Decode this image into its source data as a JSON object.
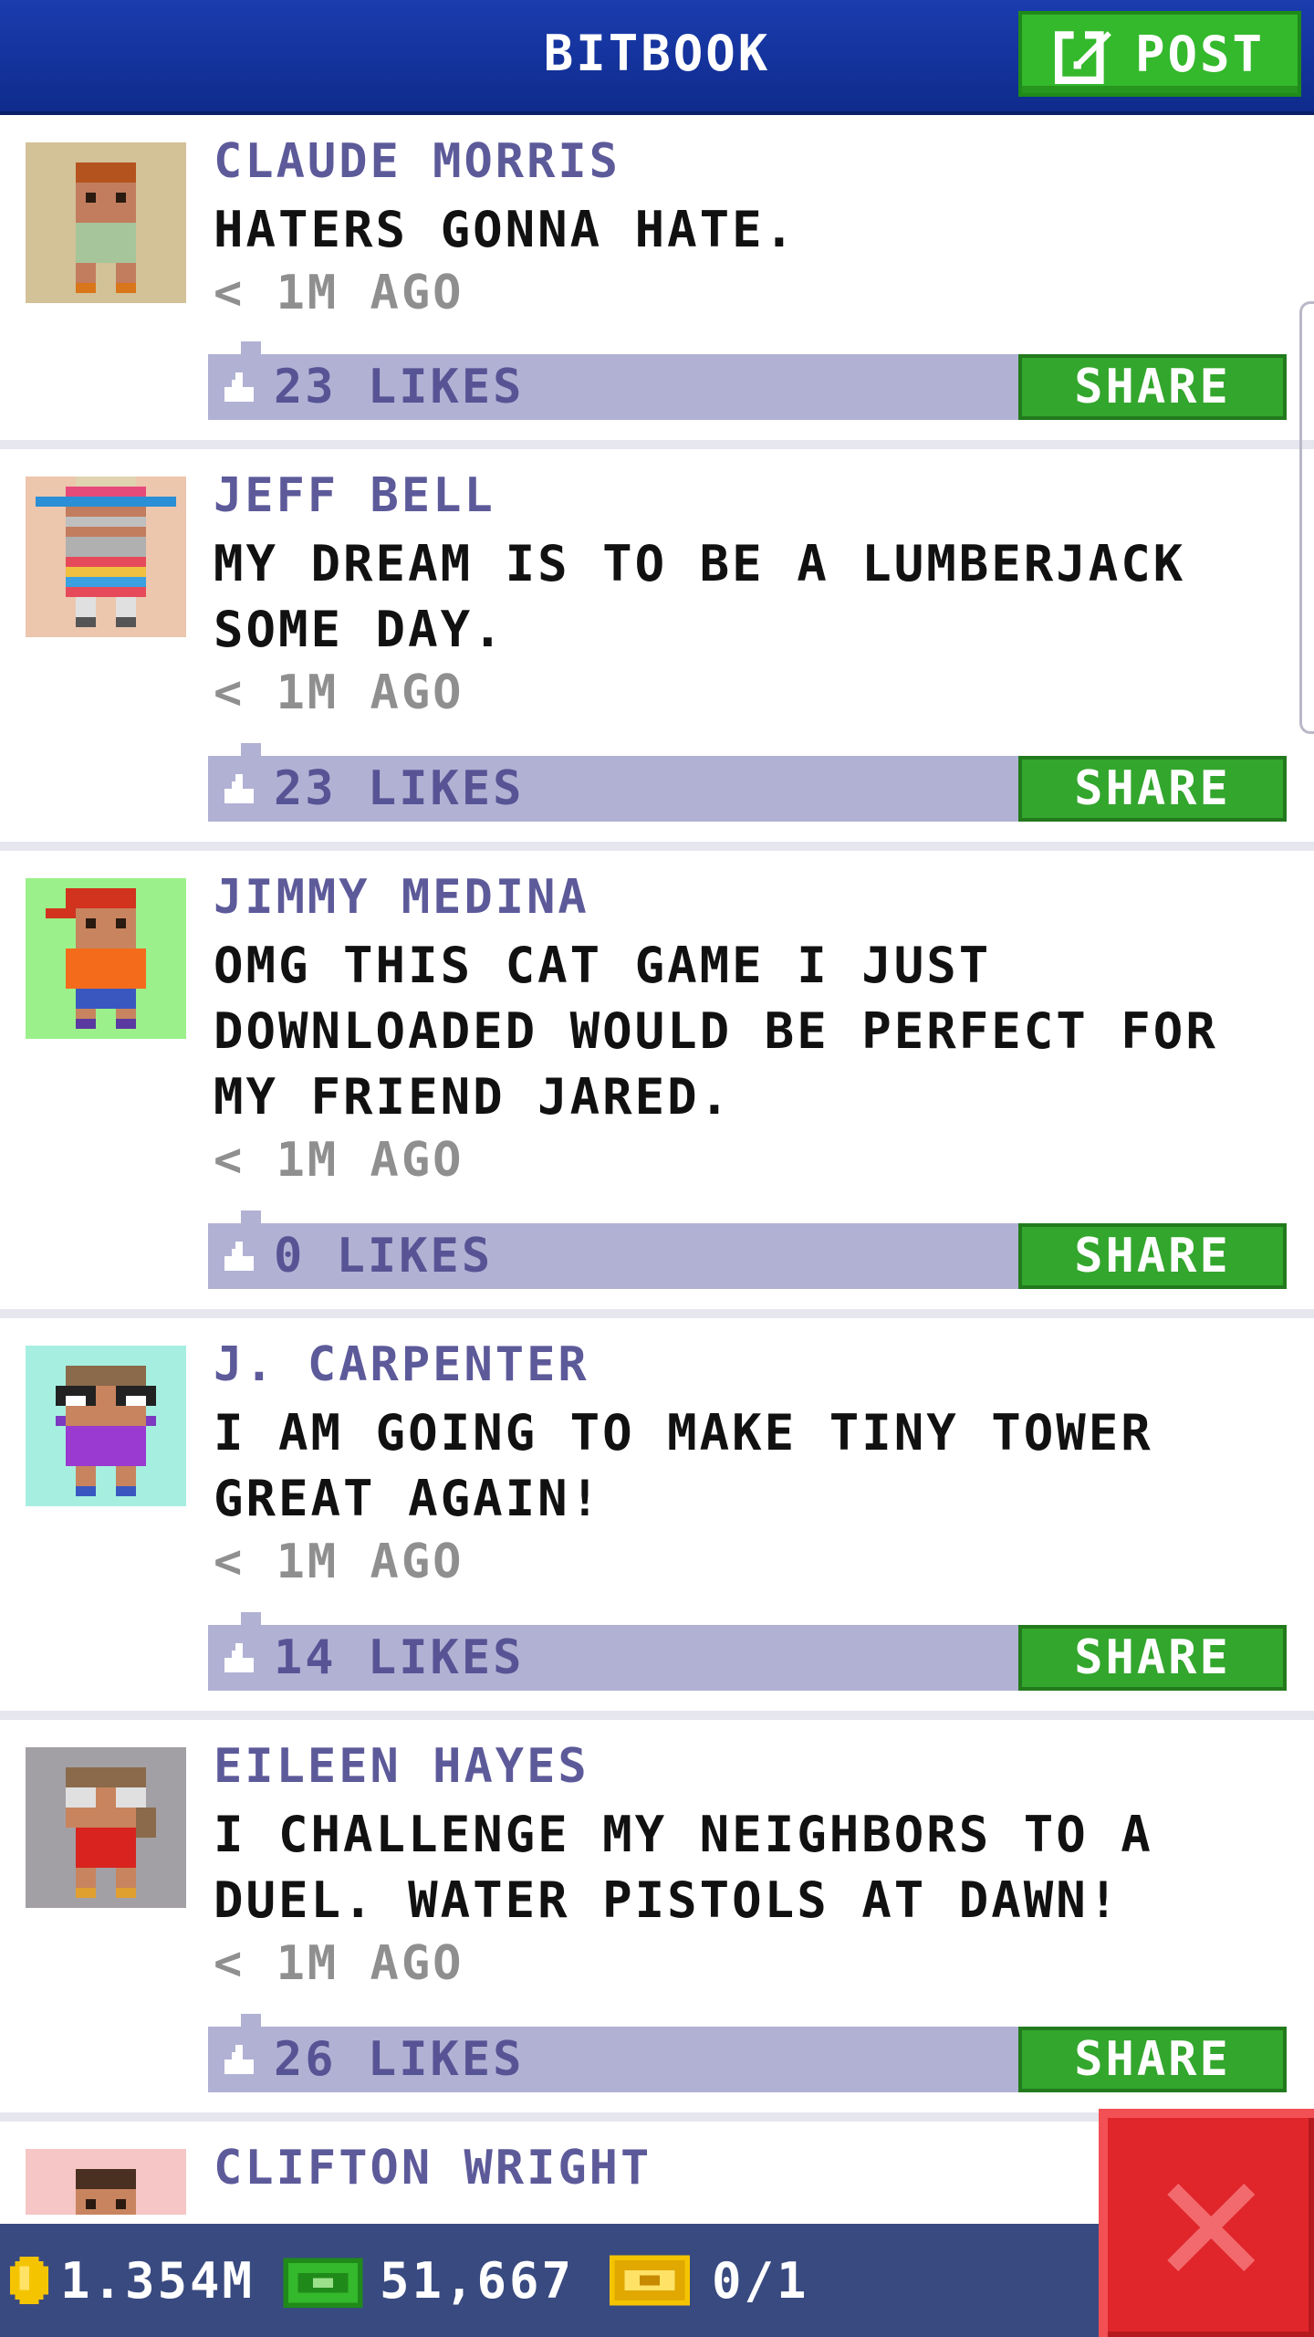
{
  "header": {
    "title": "BITBOOK",
    "post_label": "POST"
  },
  "posts": [
    {
      "author": "CLAUDE MORRIS",
      "message": "HATERS GONNA HATE.",
      "time": "< 1M AGO",
      "likes": "23 LIKES",
      "share_label": "SHARE",
      "avatar_bg": "#d3c197"
    },
    {
      "author": "JEFF BELL",
      "message": "MY DREAM IS TO BE A LUMBERJACK SOME DAY.",
      "time": "< 1M AGO",
      "likes": "23 LIKES",
      "share_label": "SHARE",
      "avatar_bg": "#ecc6ad"
    },
    {
      "author": "JIMMY MEDINA",
      "message": "OMG THIS CAT GAME I JUST DOWNLOADED WOULD BE PERFECT FOR MY FRIEND JARED.",
      "time": "< 1M AGO",
      "likes": "0 LIKES",
      "share_label": "SHARE",
      "avatar_bg": "#9bf08b"
    },
    {
      "author": "J. CARPENTER",
      "message": "I AM GOING TO MAKE TINY TOWER GREAT AGAIN!",
      "time": "< 1M AGO",
      "likes": "14 LIKES",
      "share_label": "SHARE",
      "avatar_bg": "#a6efe0"
    },
    {
      "author": "EILEEN HAYES",
      "message": "I CHALLENGE MY NEIGHBORS TO A DUEL. WATER PISTOLS AT DAWN!",
      "time": "< 1M AGO",
      "likes": "26 LIKES",
      "share_label": "SHARE",
      "avatar_bg": "#a3a0a5"
    },
    {
      "author": "CLIFTON WRIGHT",
      "message": "",
      "time": "",
      "likes": "",
      "share_label": "",
      "avatar_bg": "#f6c5c5"
    }
  ],
  "status": {
    "coins": "1.354M",
    "bux": "51,667",
    "tickets": "0/1"
  },
  "colors": {
    "header": "#1a3cae",
    "post_button": "#34b82c",
    "share_button": "#33a62d",
    "likes_bar": "#b1b1d4",
    "close_button": "#e0262b",
    "status_bar": "#394a80"
  }
}
